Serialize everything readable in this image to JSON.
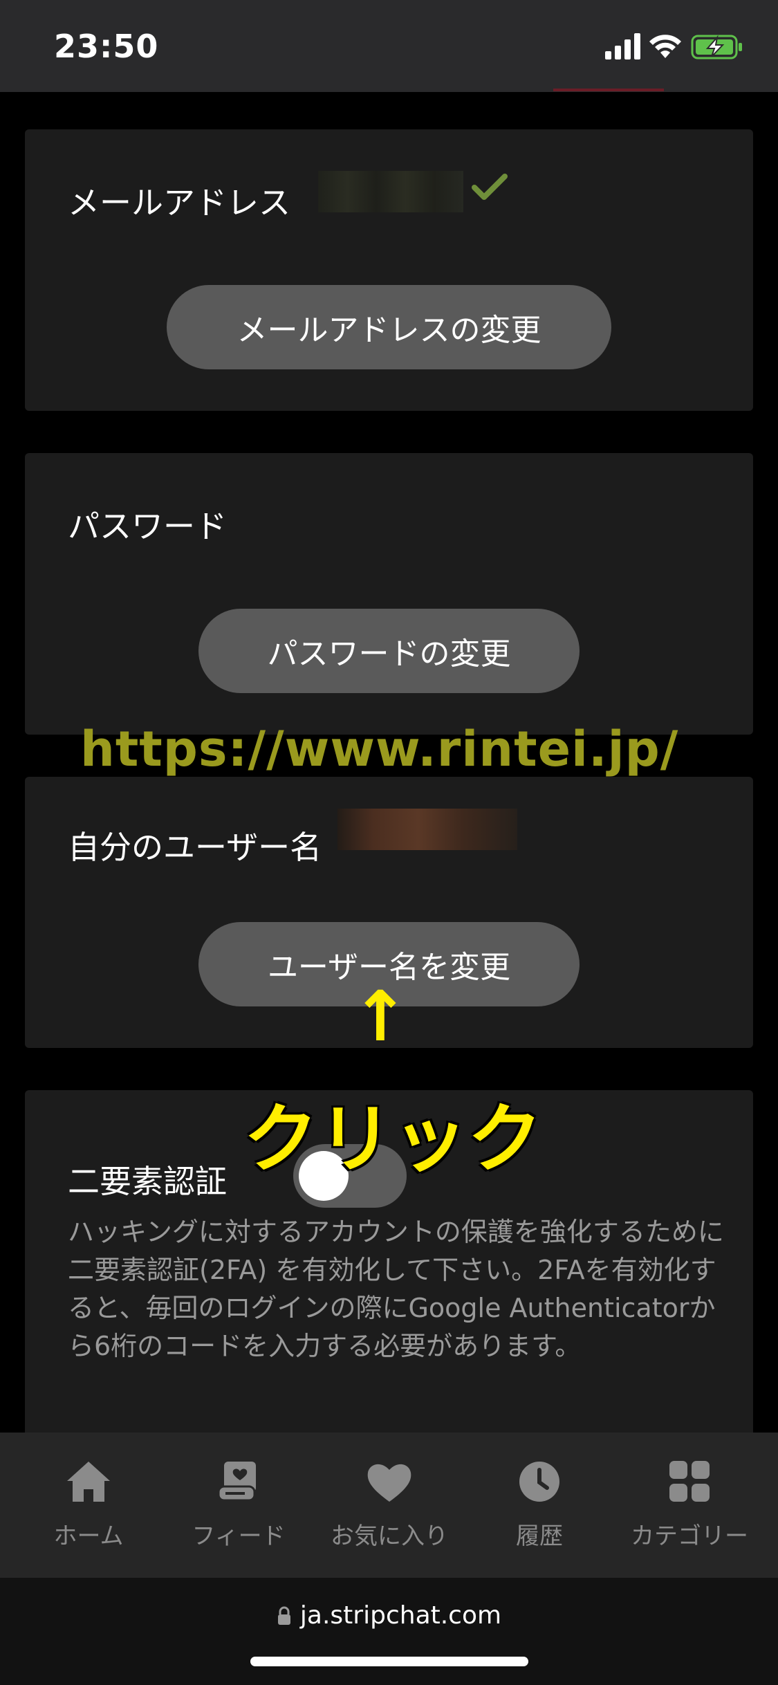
{
  "status_bar": {
    "time": "23:50"
  },
  "email_card": {
    "label": "メールアドレス",
    "button_label": "メールアドレスの変更"
  },
  "password_card": {
    "label": "パスワード",
    "button_label": "パスワードの変更"
  },
  "username_card": {
    "label": "自分のユーザー名",
    "button_label": "ユーザー名を変更"
  },
  "twofa_card": {
    "label": "二要素認証",
    "toggle_on": false,
    "description": "ハッキングに対するアカウントの保護を強化するために二要素認証(2FA) を有効化して下さい。2FAを有効化すると、毎回のログインの際にGoogle Authenticatorから6桁のコードを入力する必要があります。"
  },
  "overlays": {
    "watermark": "https://www.rintei.jp/",
    "arrow": "↑",
    "click_label": "クリック"
  },
  "bottom_nav": {
    "items": [
      {
        "label": "ホーム",
        "icon": "home-icon"
      },
      {
        "label": "フィード",
        "icon": "feed-icon"
      },
      {
        "label": "お気に入り",
        "icon": "heart-icon"
      },
      {
        "label": "履歴",
        "icon": "clock-icon"
      },
      {
        "label": "カテゴリー",
        "icon": "grid-icon"
      }
    ]
  },
  "browser": {
    "url": "ja.stripchat.com"
  },
  "colors": {
    "background": "#000000",
    "card": "#1c1c1c",
    "button": "#5a5a5a",
    "watermark": "#9a9a1e",
    "annotation": "#ffee00",
    "verified_check": "#6f8f3a"
  }
}
